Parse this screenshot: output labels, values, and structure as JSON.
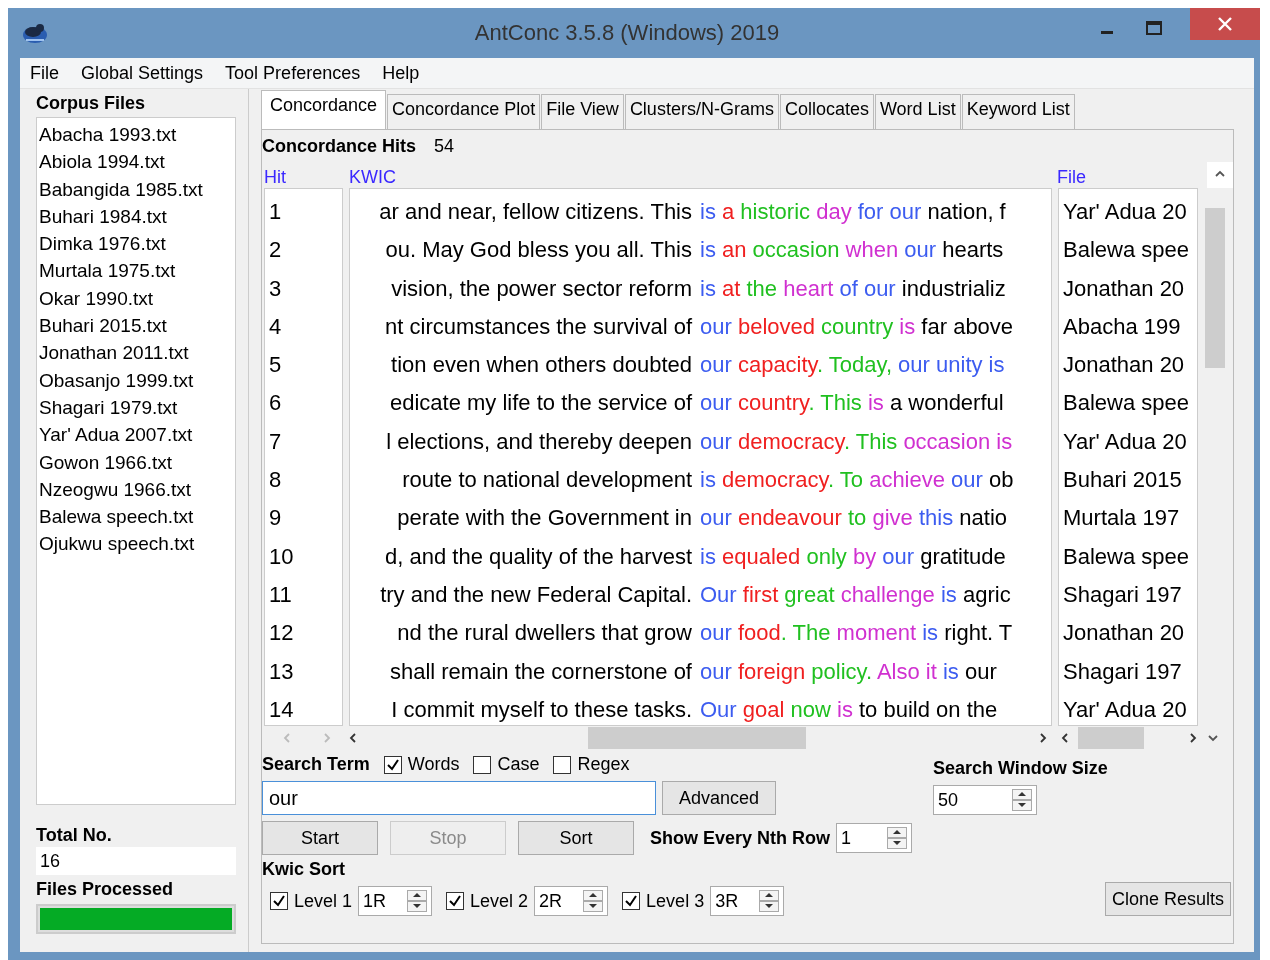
{
  "window": {
    "title": "AntConc 3.5.8 (Windows) 2019"
  },
  "menu": [
    "File",
    "Global Settings",
    "Tool Preferences",
    "Help"
  ],
  "corpus_files": {
    "label": "Corpus Files",
    "items": [
      "Abacha 1993.txt",
      "Abiola 1994.txt",
      "Babangida 1985.txt",
      "Buhari 1984.txt",
      "Dimka 1976.txt",
      "Murtala 1975.txt",
      "Okar 1990.txt",
      "Buhari 2015.txt",
      "Jonathan 2011.txt",
      "Obasanjo 1999.txt",
      "Shagari 1979.txt",
      "Yar' Adua 2007.txt",
      "Gowon 1966.txt",
      "Nzeogwu 1966.txt",
      "Balewa speech.txt",
      "Ojukwu speech.txt"
    ]
  },
  "total": {
    "label": "Total No.",
    "value": "16"
  },
  "files_processed": {
    "label": "Files Processed",
    "level": 1
  },
  "tabs": [
    {
      "label": "Concordance",
      "selected": true
    },
    {
      "label": "Concordance Plot",
      "selected": false
    },
    {
      "label": "File View",
      "selected": false
    },
    {
      "label": "Clusters/N-Grams",
      "selected": false
    },
    {
      "label": "Collocates",
      "selected": false
    },
    {
      "label": "Word List",
      "selected": false
    },
    {
      "label": "Keyword List",
      "selected": false
    }
  ],
  "hits": {
    "label": "Concordance Hits",
    "value": "54"
  },
  "table": {
    "columns": [
      "Hit",
      "KWIC",
      "File"
    ],
    "rows": [
      {
        "hit": "1",
        "left": "ar and near, fellow citizens. This",
        "right": [
          {
            "text": "is",
            "color": "#3c5cf0"
          },
          {
            "text": " a",
            "color": "#f02020"
          },
          {
            "text": " historic",
            "color": "#20c020"
          },
          {
            "text": " day",
            "color": "#d030d0"
          },
          {
            "text": " for our",
            "color": "#3c5cf0"
          },
          {
            "text": " nation, f",
            "color": "#000000"
          }
        ],
        "file": "Yar' Adua 20"
      },
      {
        "hit": "2",
        "left": "ou. May God bless you all. This",
        "right": [
          {
            "text": "is",
            "color": "#3c5cf0"
          },
          {
            "text": " an",
            "color": "#f02020"
          },
          {
            "text": " occasion",
            "color": "#20c020"
          },
          {
            "text": " when",
            "color": "#d030d0"
          },
          {
            "text": " our",
            "color": "#3c5cf0"
          },
          {
            "text": " hearts",
            "color": "#000000"
          }
        ],
        "file": "Balewa spee"
      },
      {
        "hit": "3",
        "left": "vision, the power sector reform",
        "right": [
          {
            "text": "is",
            "color": "#3c5cf0"
          },
          {
            "text": " at",
            "color": "#f02020"
          },
          {
            "text": " the",
            "color": "#20c020"
          },
          {
            "text": " heart",
            "color": "#d030d0"
          },
          {
            "text": " of our",
            "color": "#3c5cf0"
          },
          {
            "text": " industrializ",
            "color": "#000000"
          }
        ],
        "file": "Jonathan 20"
      },
      {
        "hit": "4",
        "left": "nt circumstances the survival of",
        "right": [
          {
            "text": "our",
            "color": "#3c5cf0"
          },
          {
            "text": " beloved",
            "color": "#f02020"
          },
          {
            "text": " country",
            "color": "#20c020"
          },
          {
            "text": " is",
            "color": "#d030d0"
          },
          {
            "text": " far above",
            "color": "#000000"
          }
        ],
        "file": "Abacha 199"
      },
      {
        "hit": "5",
        "left": "tion even when others doubted",
        "right": [
          {
            "text": "our",
            "color": "#3c5cf0"
          },
          {
            "text": " capacity",
            "color": "#f02020"
          },
          {
            "text": ". Today,",
            "color": "#20c020"
          },
          {
            "text": " our unity is",
            "color": "#3c5cf0"
          }
        ],
        "file": "Jonathan 20"
      },
      {
        "hit": "6",
        "left": "edicate my life to the service of",
        "right": [
          {
            "text": "our",
            "color": "#3c5cf0"
          },
          {
            "text": " country",
            "color": "#f02020"
          },
          {
            "text": ". This",
            "color": "#20c020"
          },
          {
            "text": " is",
            "color": "#d030d0"
          },
          {
            "text": " a wonderful",
            "color": "#000000"
          }
        ],
        "file": "Balewa spee"
      },
      {
        "hit": "7",
        "left": "l elections, and thereby deepen",
        "right": [
          {
            "text": "our",
            "color": "#3c5cf0"
          },
          {
            "text": " democracy",
            "color": "#f02020"
          },
          {
            "text": ". This",
            "color": "#20c020"
          },
          {
            "text": " occasion is",
            "color": "#d030d0"
          }
        ],
        "file": "Yar' Adua 20"
      },
      {
        "hit": "8",
        "left": "route to national development",
        "right": [
          {
            "text": "is",
            "color": "#3c5cf0"
          },
          {
            "text": " democracy",
            "color": "#f02020"
          },
          {
            "text": ". To",
            "color": "#20c020"
          },
          {
            "text": " achieve",
            "color": "#d030d0"
          },
          {
            "text": " our",
            "color": "#3c5cf0"
          },
          {
            "text": " ob",
            "color": "#000000"
          }
        ],
        "file": "Buhari 2015"
      },
      {
        "hit": "9",
        "left": "perate with the Government in",
        "right": [
          {
            "text": "our",
            "color": "#3c5cf0"
          },
          {
            "text": " endeavour",
            "color": "#f02020"
          },
          {
            "text": " to",
            "color": "#20c020"
          },
          {
            "text": " give",
            "color": "#d030d0"
          },
          {
            "text": " this",
            "color": "#3c5cf0"
          },
          {
            "text": " natio",
            "color": "#000000"
          }
        ],
        "file": "Murtala 197"
      },
      {
        "hit": "10",
        "left": "d, and the quality of the harvest",
        "right": [
          {
            "text": "is",
            "color": "#3c5cf0"
          },
          {
            "text": " equaled",
            "color": "#f02020"
          },
          {
            "text": " only",
            "color": "#20c020"
          },
          {
            "text": " by",
            "color": "#d030d0"
          },
          {
            "text": " our",
            "color": "#3c5cf0"
          },
          {
            "text": " gratitude",
            "color": "#000000"
          }
        ],
        "file": "Balewa spee"
      },
      {
        "hit": "11",
        "left": "try and the new Federal Capital.",
        "right": [
          {
            "text": "Our",
            "color": "#3c5cf0"
          },
          {
            "text": " first",
            "color": "#f02020"
          },
          {
            "text": " great",
            "color": "#20c020"
          },
          {
            "text": " challenge",
            "color": "#d030d0"
          },
          {
            "text": " is",
            "color": "#3c5cf0"
          },
          {
            "text": " agric",
            "color": "#000000"
          }
        ],
        "file": "Shagari 197"
      },
      {
        "hit": "12",
        "left": "nd the rural dwellers that grow",
        "right": [
          {
            "text": "our",
            "color": "#3c5cf0"
          },
          {
            "text": " food",
            "color": "#f02020"
          },
          {
            "text": ". The",
            "color": "#20c020"
          },
          {
            "text": " moment",
            "color": "#d030d0"
          },
          {
            "text": " is",
            "color": "#3c5cf0"
          },
          {
            "text": " right. T",
            "color": "#000000"
          }
        ],
        "file": "Jonathan 20"
      },
      {
        "hit": "13",
        "left": "shall remain the cornerstone of",
        "right": [
          {
            "text": "our",
            "color": "#3c5cf0"
          },
          {
            "text": " foreign",
            "color": "#f02020"
          },
          {
            "text": " policy.",
            "color": "#20c020"
          },
          {
            "text": " Also it",
            "color": "#d030d0"
          },
          {
            "text": " is",
            "color": "#3c5cf0"
          },
          {
            "text": " our",
            "color": "#000000"
          }
        ],
        "file": "Shagari 197"
      },
      {
        "hit": "14",
        "left": "I commit myself to these tasks.",
        "right": [
          {
            "text": "Our",
            "color": "#3c5cf0"
          },
          {
            "text": " goal",
            "color": "#f02020"
          },
          {
            "text": " now",
            "color": "#20c020"
          },
          {
            "text": " is",
            "color": "#d030d0"
          },
          {
            "text": " to build on the",
            "color": "#000000"
          }
        ],
        "file": "Yar' Adua 20"
      }
    ]
  },
  "search": {
    "label": "Search Term",
    "options": [
      {
        "label": "Words",
        "checked": true
      },
      {
        "label": "Case",
        "checked": false
      },
      {
        "label": "Regex",
        "checked": false
      }
    ],
    "value": "our",
    "advanced": "Advanced"
  },
  "buttons": [
    {
      "label": "Start",
      "disabled": false
    },
    {
      "label": "Stop",
      "disabled": true
    },
    {
      "label": "Sort",
      "disabled": false
    }
  ],
  "nth_row": {
    "label": "Show Every Nth Row",
    "value": "1"
  },
  "window_size": {
    "label": "Search Window Size",
    "value": "50"
  },
  "kwic_sort": {
    "label": "Kwic Sort",
    "levels": [
      {
        "label": "Level 1",
        "checked": true,
        "value": "1R"
      },
      {
        "label": "Level 2",
        "checked": true,
        "value": "2R"
      },
      {
        "label": "Level 3",
        "checked": true,
        "value": "3R"
      }
    ]
  },
  "clone": "Clone Results"
}
